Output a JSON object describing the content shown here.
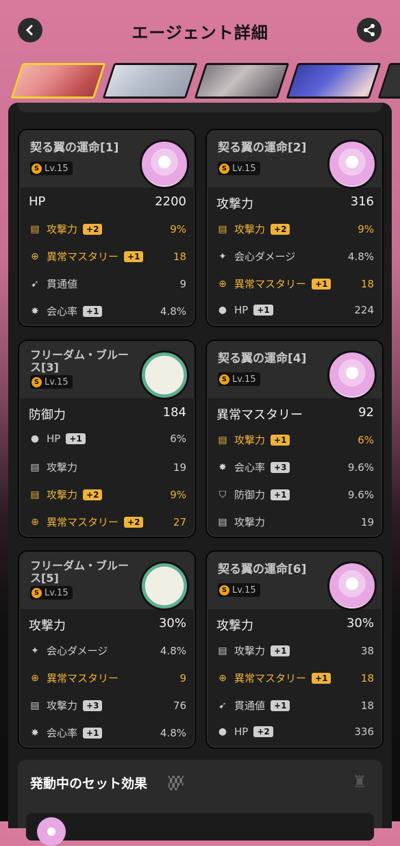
{
  "header": {
    "title": "エージェント詳細"
  },
  "agents": [
    "agent-1",
    "agent-2",
    "agent-3",
    "agent-4"
  ],
  "colors": {
    "accent": "#f0b238",
    "active_tab": "#f2d22b",
    "header_bg": "#d87a9e"
  },
  "discs": [
    {
      "name": "契る翼の運命[1]",
      "level": "Lv.15",
      "disc_color": "pink",
      "main": {
        "label": "HP",
        "value": "2200"
      },
      "subs": [
        {
          "icon": "attack-icon",
          "label": "攻撃力",
          "badge": "+2",
          "value": "9%",
          "hl": true
        },
        {
          "icon": "anomaly-icon",
          "label": "異常マスタリー",
          "badge": "+1",
          "value": "18",
          "hl": true
        },
        {
          "icon": "pen-icon",
          "label": "貫通値",
          "badge": "",
          "value": "9",
          "hl": false
        },
        {
          "icon": "crit-icon",
          "label": "会心率",
          "badge": "+1",
          "value": "4.8%",
          "hl": false
        }
      ]
    },
    {
      "name": "契る翼の運命[2]",
      "level": "Lv.15",
      "disc_color": "pink",
      "main": {
        "label": "攻撃力",
        "value": "316"
      },
      "subs": [
        {
          "icon": "attack-icon",
          "label": "攻撃力",
          "badge": "+2",
          "value": "9%",
          "hl": true
        },
        {
          "icon": "crit-dmg-icon",
          "label": "会心ダメージ",
          "badge": "",
          "value": "4.8%",
          "hl": false
        },
        {
          "icon": "anomaly-icon",
          "label": "異常マスタリー",
          "badge": "+1",
          "value": "18",
          "hl": true
        },
        {
          "icon": "hp-icon",
          "label": "HP",
          "badge": "+1",
          "value": "224",
          "hl": false
        }
      ]
    },
    {
      "name": "フリーダム・ブルース[3]",
      "level": "Lv.15",
      "disc_color": "green",
      "main": {
        "label": "防御力",
        "value": "184"
      },
      "subs": [
        {
          "icon": "hp-icon",
          "label": "HP",
          "badge": "+1",
          "value": "6%",
          "hl": false
        },
        {
          "icon": "attack-icon",
          "label": "攻撃力",
          "badge": "",
          "value": "19",
          "hl": false
        },
        {
          "icon": "attack-icon",
          "label": "攻撃力",
          "badge": "+2",
          "value": "9%",
          "hl": true
        },
        {
          "icon": "anomaly-icon",
          "label": "異常マスタリー",
          "badge": "+2",
          "value": "27",
          "hl": true
        }
      ]
    },
    {
      "name": "契る翼の運命[4]",
      "level": "Lv.15",
      "disc_color": "pink",
      "main": {
        "label": "異常マスタリー",
        "value": "92"
      },
      "subs": [
        {
          "icon": "attack-icon",
          "label": "攻撃力",
          "badge": "+1",
          "value": "6%",
          "hl": true
        },
        {
          "icon": "crit-icon",
          "label": "会心率",
          "badge": "+3",
          "value": "9.6%",
          "hl": false
        },
        {
          "icon": "def-icon",
          "label": "防御力",
          "badge": "+1",
          "value": "9.6%",
          "hl": false
        },
        {
          "icon": "attack-icon",
          "label": "攻撃力",
          "badge": "",
          "value": "19",
          "hl": false
        }
      ]
    },
    {
      "name": "フリーダム・ブルース[5]",
      "level": "Lv.15",
      "disc_color": "green",
      "main": {
        "label": "攻撃力",
        "value": "30%"
      },
      "subs": [
        {
          "icon": "crit-dmg-icon",
          "label": "会心ダメージ",
          "badge": "",
          "value": "4.8%",
          "hl": false
        },
        {
          "icon": "anomaly-icon",
          "label": "異常マスタリー",
          "badge": "",
          "value": "9",
          "hl": true
        },
        {
          "icon": "attack-icon",
          "label": "攻撃力",
          "badge": "+3",
          "value": "76",
          "hl": false
        },
        {
          "icon": "crit-icon",
          "label": "会心率",
          "badge": "+1",
          "value": "4.8%",
          "hl": false
        }
      ]
    },
    {
      "name": "契る翼の運命[6]",
      "level": "Lv.15",
      "disc_color": "pink",
      "main": {
        "label": "攻撃力",
        "value": "30%"
      },
      "subs": [
        {
          "icon": "attack-icon",
          "label": "攻撃力",
          "badge": "+1",
          "value": "38",
          "hl": false
        },
        {
          "icon": "anomaly-icon",
          "label": "異常マスタリー",
          "badge": "+1",
          "value": "18",
          "hl": true
        },
        {
          "icon": "pen-icon",
          "label": "貫通値",
          "badge": "+1",
          "value": "18",
          "hl": false
        },
        {
          "icon": "hp-icon",
          "label": "HP",
          "badge": "+2",
          "value": "336",
          "hl": false
        }
      ]
    }
  ],
  "set_effects": {
    "title": "発動中のセット効果"
  }
}
